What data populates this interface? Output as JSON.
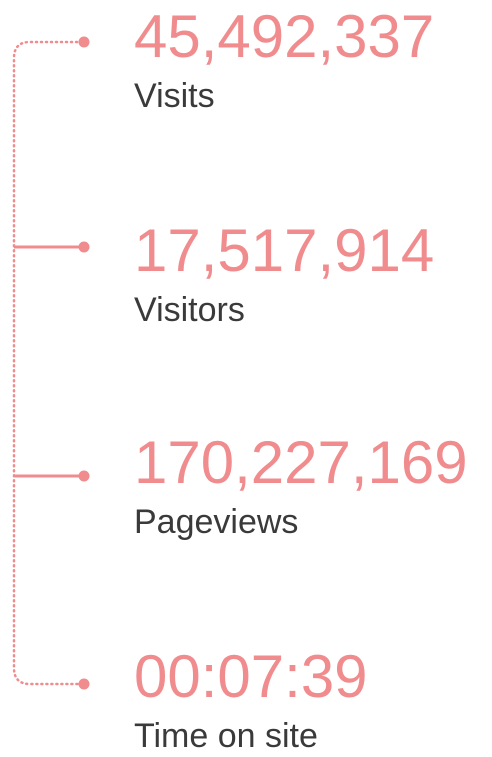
{
  "accent_color": "#f08c8e",
  "label_color": "#3a3a3a",
  "stats": [
    {
      "value": "45,492,337",
      "label": "Visits"
    },
    {
      "value": "17,517,914",
      "label": "Visitors"
    },
    {
      "value": "170,227,169",
      "label": "Pageviews"
    },
    {
      "value": "00:07:39",
      "label": "Time on site"
    }
  ]
}
